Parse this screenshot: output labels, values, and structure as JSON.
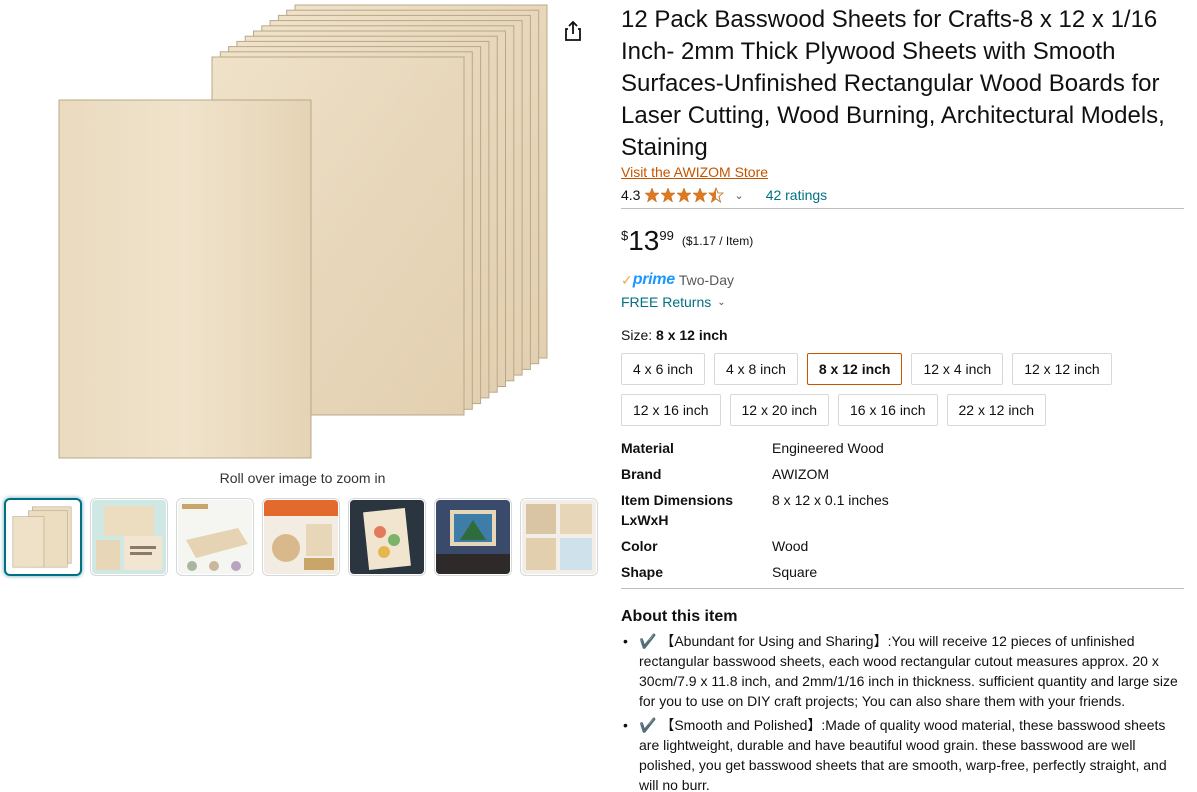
{
  "gallery": {
    "zoom_hint": "Roll over image to zoom in",
    "main_image_alt": "basswood sheets stack",
    "thumbnails": [
      {
        "name": "thumb-sheets-stack",
        "selected": true
      },
      {
        "name": "thumb-sheets-label",
        "selected": false
      },
      {
        "name": "thumb-product-details",
        "selected": false
      },
      {
        "name": "thumb-diy-crafts",
        "selected": false
      },
      {
        "name": "thumb-painted-sheet",
        "selected": false
      },
      {
        "name": "thumb-framed-art",
        "selected": false
      },
      {
        "name": "thumb-uses-collage",
        "selected": false
      }
    ]
  },
  "product": {
    "title": "12 Pack Basswood Sheets for Crafts-8 x 12 x 1/16 Inch- 2mm Thick Plywood Sheets with Smooth Surfaces-Unfinished Rectangular Wood Boards for Laser Cutting, Wood Burning, Architectural Models, Staining",
    "store_link": "Visit the AWIZOM Store",
    "rating_value": "4.3",
    "ratings_count": "42 ratings",
    "price_symbol": "$",
    "price_whole": "13",
    "price_fraction": "99",
    "unit_price": "($1.17 / Item)",
    "prime_check": "✓",
    "prime_word": "prime",
    "prime_speed": "Two-Day",
    "returns": "FREE Returns"
  },
  "size": {
    "label": "Size: ",
    "selected": "8 x 12 inch",
    "options": [
      {
        "label": "4 x 6 inch",
        "selected": false
      },
      {
        "label": "4 x 8 inch",
        "selected": false
      },
      {
        "label": "8 x 12 inch",
        "selected": true
      },
      {
        "label": "12 x 4 inch",
        "selected": false
      },
      {
        "label": "12 x 12 inch",
        "selected": false
      },
      {
        "label": "12 x 16 inch",
        "selected": false
      },
      {
        "label": "12 x 20 inch",
        "selected": false
      },
      {
        "label": "16 x 16 inch",
        "selected": false
      },
      {
        "label": "22 x 12 inch",
        "selected": false
      }
    ]
  },
  "specs": [
    {
      "key": "Material",
      "value": "Engineered Wood"
    },
    {
      "key": "Brand",
      "value": "AWIZOM"
    },
    {
      "key": "Item Dimensions LxWxH",
      "value": "8 x 12 x 0.1 inches"
    },
    {
      "key": "Color",
      "value": "Wood"
    },
    {
      "key": "Shape",
      "value": "Square"
    }
  ],
  "about": {
    "title": "About this item",
    "bullets": [
      "✔️ 【Abundant for Using and Sharing】:You will receive 12 pieces of unfinished rectangular basswood sheets, each wood rectangular cutout measures approx. 20 x 30cm/7.9 x 11.8 inch, and 2mm/1/16 inch in thickness. sufficient quantity and large size for you to use on DIY craft projects; You can also share them with your friends.",
      "✔️ 【Smooth and Polished】:Made of quality wood material, these basswood sheets are lightweight, durable and have beautiful wood grain. these basswood are well polished, you get basswood sheets that are smooth, warp-free, perfectly straight, and will no burr."
    ]
  },
  "colors": {
    "link": "#007185",
    "store_link": "#c45500",
    "star": "#de7921",
    "prime_blue": "#1a98ff",
    "prime_check": "#f3a847",
    "selected_border": "#c45500",
    "wood": "#eadbc1"
  },
  "icons": {
    "share": "share-icon",
    "star": "star-icon",
    "chevron": "chevron-down-icon"
  }
}
